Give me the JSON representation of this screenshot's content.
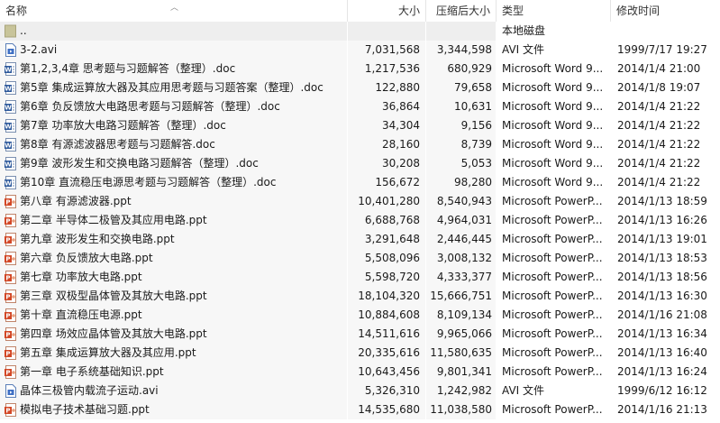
{
  "columns": {
    "name": "名称",
    "size": "大小",
    "compressed": "压缩后大小",
    "type": "类型",
    "modified": "修改时间"
  },
  "parent": {
    "name": "..",
    "type": "本地磁盘"
  },
  "files": [
    {
      "name": "3-2.avi",
      "size": "7,031,568",
      "compressed": "3,344,598",
      "type": "AVI 文件",
      "modified": "1999/7/17 19:27",
      "icon": "video-file-icon"
    },
    {
      "name": "第1,2,3,4章 思考题与习题解答（整理）.doc",
      "size": "1,217,536",
      "compressed": "680,929",
      "type": "Microsoft Word 9...",
      "modified": "2014/1/4 21:00",
      "icon": "word-doc-icon"
    },
    {
      "name": "第5章  集成运算放大器及其应用思考题与习题答案（整理）.doc",
      "size": "122,880",
      "compressed": "79,658",
      "type": "Microsoft Word 9...",
      "modified": "2014/1/8 19:07",
      "icon": "word-doc-icon"
    },
    {
      "name": "第6章  负反馈放大电路思考题与习题解答（整理）.doc",
      "size": "36,864",
      "compressed": "10,631",
      "type": "Microsoft Word 9...",
      "modified": "2014/1/4 21:22",
      "icon": "word-doc-icon"
    },
    {
      "name": "第7章  功率放大电路习题解答（整理）.doc",
      "size": "34,304",
      "compressed": "9,156",
      "type": "Microsoft Word 9...",
      "modified": "2014/1/4 21:22",
      "icon": "word-doc-icon"
    },
    {
      "name": "第8章 有源滤波器思考题与习题解答.doc",
      "size": "28,160",
      "compressed": "8,739",
      "type": "Microsoft Word 9...",
      "modified": "2014/1/4 21:22",
      "icon": "word-doc-icon"
    },
    {
      "name": "第9章  波形发生和交换电路习题解答（整理）.doc",
      "size": "30,208",
      "compressed": "5,053",
      "type": "Microsoft Word 9...",
      "modified": "2014/1/4 21:22",
      "icon": "word-doc-icon"
    },
    {
      "name": "第10章  直流稳压电源思考题与习题解答（整理）.doc",
      "size": "156,672",
      "compressed": "98,280",
      "type": "Microsoft Word 9...",
      "modified": "2014/1/4 21:22",
      "icon": "word-doc-icon"
    },
    {
      "name": "第八章  有源滤波器.ppt",
      "size": "10,401,280",
      "compressed": "8,540,943",
      "type": "Microsoft PowerP...",
      "modified": "2014/1/13 18:59",
      "icon": "powerpoint-icon"
    },
    {
      "name": "第二章  半导体二极管及其应用电路.ppt",
      "size": "6,688,768",
      "compressed": "4,964,031",
      "type": "Microsoft PowerP...",
      "modified": "2014/1/13 16:26",
      "icon": "powerpoint-icon"
    },
    {
      "name": "第九章  波形发生和交换电路.ppt",
      "size": "3,291,648",
      "compressed": "2,446,445",
      "type": "Microsoft PowerP...",
      "modified": "2014/1/13 19:01",
      "icon": "powerpoint-icon"
    },
    {
      "name": "第六章   负反馈放大电路.ppt",
      "size": "5,508,096",
      "compressed": "3,008,132",
      "type": "Microsoft PowerP...",
      "modified": "2014/1/13 18:53",
      "icon": "powerpoint-icon"
    },
    {
      "name": "第七章  功率放大电路.ppt",
      "size": "5,598,720",
      "compressed": "4,333,377",
      "type": "Microsoft PowerP...",
      "modified": "2014/1/13 18:56",
      "icon": "powerpoint-icon"
    },
    {
      "name": "第三章  双极型晶体管及其放大电路.ppt",
      "size": "18,104,320",
      "compressed": "15,666,751",
      "type": "Microsoft PowerP...",
      "modified": "2014/1/13 16:30",
      "icon": "powerpoint-icon"
    },
    {
      "name": "第十章  直流稳压电源.ppt",
      "size": "10,884,608",
      "compressed": "8,109,134",
      "type": "Microsoft PowerP...",
      "modified": "2014/1/16 21:08",
      "icon": "powerpoint-icon"
    },
    {
      "name": "第四章  场效应晶体管及其放大电路.ppt",
      "size": "14,511,616",
      "compressed": "9,965,066",
      "type": "Microsoft PowerP...",
      "modified": "2014/1/13 16:34",
      "icon": "powerpoint-icon"
    },
    {
      "name": "第五章  集成运算放大器及其应用.ppt",
      "size": "20,335,616",
      "compressed": "11,580,635",
      "type": "Microsoft PowerP...",
      "modified": "2014/1/13 16:40",
      "icon": "powerpoint-icon"
    },
    {
      "name": "第一章  电子系统基础知识.ppt",
      "size": "10,643,456",
      "compressed": "9,801,341",
      "type": "Microsoft PowerP...",
      "modified": "2014/1/13 16:24",
      "icon": "powerpoint-icon"
    },
    {
      "name": "晶体三极管内载流子运动.avi",
      "size": "5,326,310",
      "compressed": "1,242,982",
      "type": "AVI 文件",
      "modified": "1999/6/12 16:12",
      "icon": "video-file-icon"
    },
    {
      "name": "模拟电子技术基础习题.ppt",
      "size": "14,535,680",
      "compressed": "11,038,580",
      "type": "Microsoft PowerP...",
      "modified": "2014/1/16 21:13",
      "icon": "powerpoint-icon"
    }
  ]
}
